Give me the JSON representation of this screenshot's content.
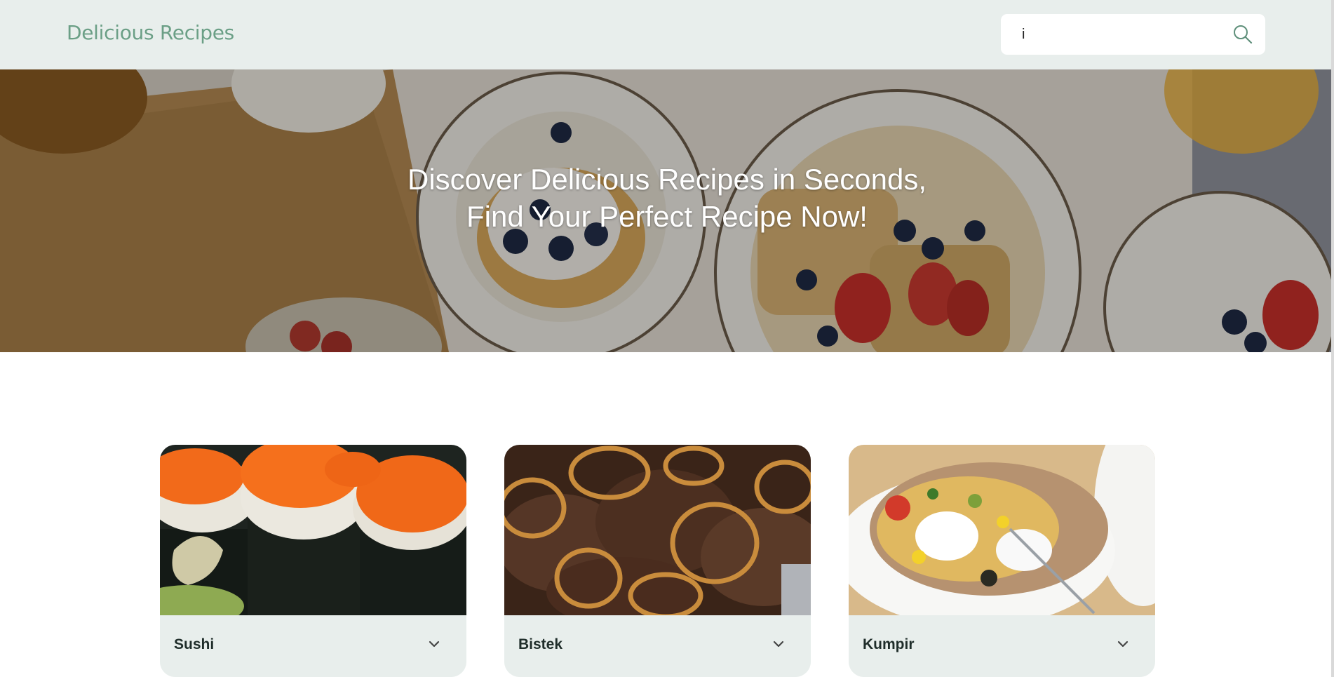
{
  "header": {
    "brand": "Delicious Recipes",
    "search_value": "i",
    "search_placeholder": ""
  },
  "hero": {
    "line1": "Discover Delicious Recipes in Seconds,",
    "line2": "Find Your Perfect Recipe Now!"
  },
  "recipes": [
    {
      "title": "Sushi"
    },
    {
      "title": "Bistek"
    },
    {
      "title": "Kumpir"
    }
  ],
  "icons": {
    "search": "search-icon",
    "expand": "chevron-down-icon"
  },
  "colors": {
    "header_bg": "#e8eeec",
    "brand": "#6b9f86",
    "card_bg": "#e8eeec",
    "card_title": "#1f2d2a"
  }
}
